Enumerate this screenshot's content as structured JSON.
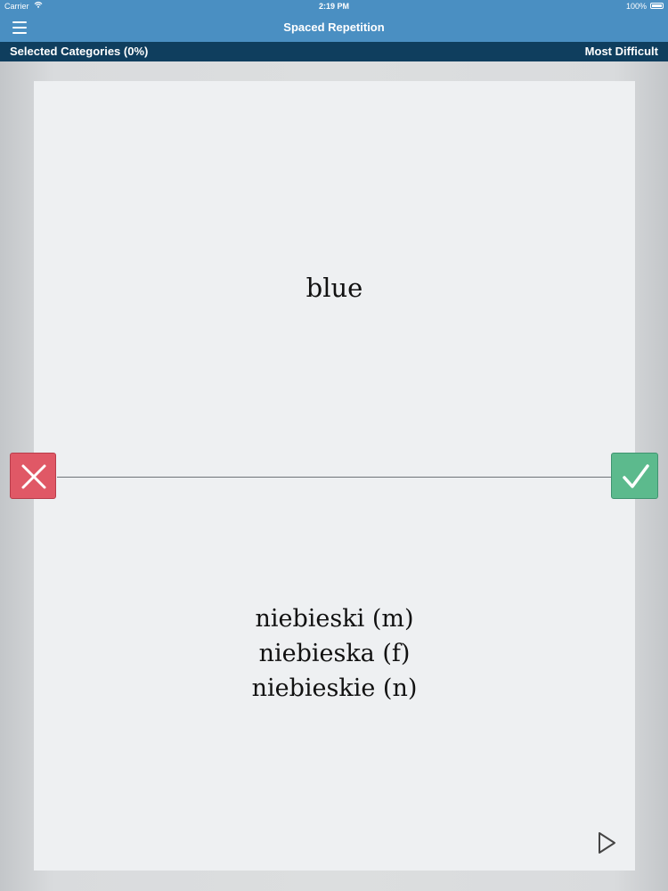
{
  "status_bar": {
    "carrier": "Carrier",
    "wifi_icon": "wifi-icon",
    "time": "2:19 PM",
    "battery": "100%"
  },
  "nav_bar": {
    "menu_icon": "hamburger-menu-icon",
    "title": "Spaced Repetition"
  },
  "sub_bar": {
    "categories": "Selected Categories (0%)",
    "mode": "Most Difficult"
  },
  "card": {
    "front": "blue",
    "back": [
      "niebieski (m)",
      "niebieska (f)",
      "niebieskie (n)"
    ]
  },
  "actions": {
    "wrong_icon": "cross-icon",
    "correct_icon": "checkmark-icon",
    "play_icon": "play-icon"
  },
  "colors": {
    "nav": "#4a8fc2",
    "sub_bar": "#0f3e5e",
    "wrong": "#e05866",
    "correct": "#5cba8d"
  }
}
